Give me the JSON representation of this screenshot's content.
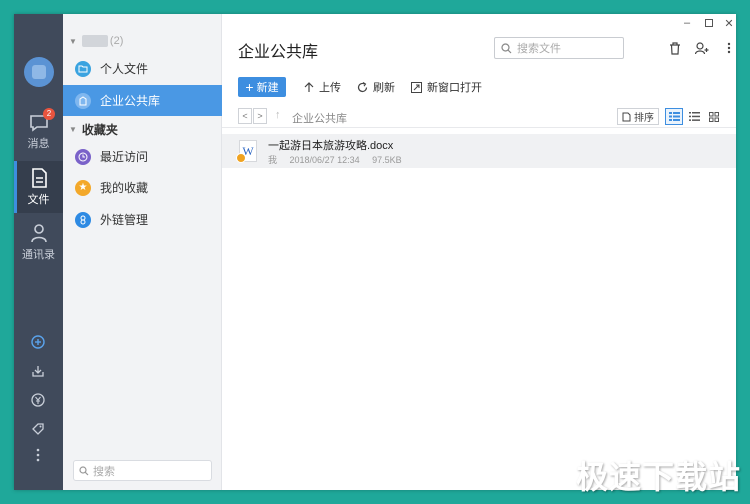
{
  "rail": {
    "messages_label": "消息",
    "messages_badge": "2",
    "files_label": "文件",
    "contacts_label": "通讯录"
  },
  "panel": {
    "group1_count": "(2)",
    "personal_files": "个人文件",
    "enterprise_library": "企业公共库",
    "favorites_head": "收藏夹",
    "recent": "最近访问",
    "my_favorites": "我的收藏",
    "external_links": "外链管理",
    "search_placeholder": "搜索"
  },
  "main": {
    "title": "企业公共库",
    "search_placeholder": "搜索文件",
    "toolbar": {
      "new": "新建",
      "upload": "上传",
      "refresh": "刷新",
      "new_window": "新窗口打开"
    },
    "breadcrumb": "企业公共库",
    "sort": "排序",
    "files": [
      {
        "name": "一起游日本旅游攻略.docx",
        "owner": "我",
        "date": "2018/06/27 12:34",
        "size": "97.5KB"
      }
    ]
  },
  "watermark": "极速下载站",
  "colors": {
    "accent": "#3d8ee0",
    "rail": "#404a5b",
    "frame": "#1fa89a",
    "badge": "#e8543f"
  }
}
